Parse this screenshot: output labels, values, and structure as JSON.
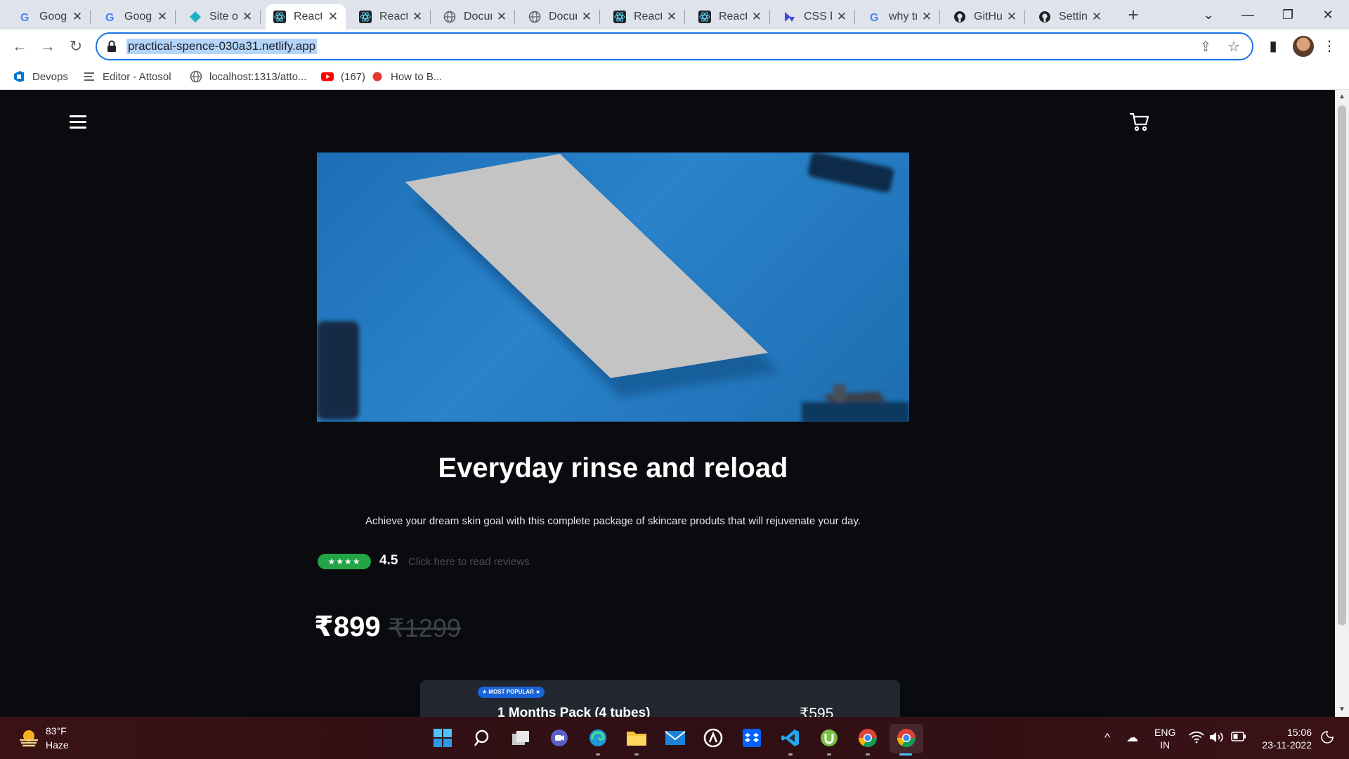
{
  "browser": {
    "tabs": [
      {
        "title": "Googl",
        "icon": "google-icon"
      },
      {
        "title": "Googl",
        "icon": "google-icon"
      },
      {
        "title": "Site o",
        "icon": "netlify-icon"
      },
      {
        "title": "React",
        "icon": "react-icon",
        "active": true
      },
      {
        "title": "React",
        "icon": "react-icon"
      },
      {
        "title": "Docur",
        "icon": "globe-icon"
      },
      {
        "title": "Docur",
        "icon": "globe-icon"
      },
      {
        "title": "React",
        "icon": "react-icon"
      },
      {
        "title": "React",
        "icon": "react-icon"
      },
      {
        "title": "CSS b",
        "icon": "devto-icon"
      },
      {
        "title": "why tr",
        "icon": "google-icon"
      },
      {
        "title": "GitHu",
        "icon": "github-icon"
      },
      {
        "title": "Settin",
        "icon": "github-icon"
      }
    ],
    "url": "practical-spence-030a31.netlify.app",
    "bookmarks": [
      {
        "label": "Devops",
        "icon": "azure-devops-icon"
      },
      {
        "label": "Editor - Attosol",
        "icon": "editor-icon"
      },
      {
        "label": "localhost:1313/atto...",
        "icon": "globe-icon"
      },
      {
        "label": "(167)",
        "icon": "youtube-icon"
      },
      {
        "label": "How to B...",
        "icon": "red-dot-icon"
      }
    ]
  },
  "product": {
    "title": "Everyday rinse and reload",
    "description": "Achieve your dream skin goal with this complete package of skincare produts that will rejuvenate your day.",
    "stars": "★★★★",
    "rating": "4.5",
    "reviews_link": "Click here to read reviews",
    "price": "₹899",
    "old_price": "₹1299",
    "pack": {
      "badge": "★ MOST POPULAR ★",
      "title": "1 Months Pack (4 tubes)",
      "price": "₹595"
    }
  },
  "taskbar": {
    "temperature": "83°F",
    "condition": "Haze",
    "lang_line1": "ENG",
    "lang_line2": "IN",
    "time": "15:06",
    "date": "23-11-2022"
  },
  "colors": {
    "accent": "#1a73e8",
    "page_bg": "#0a0b0f",
    "rating_green": "#22a447",
    "badge_blue": "#1a63d8"
  }
}
